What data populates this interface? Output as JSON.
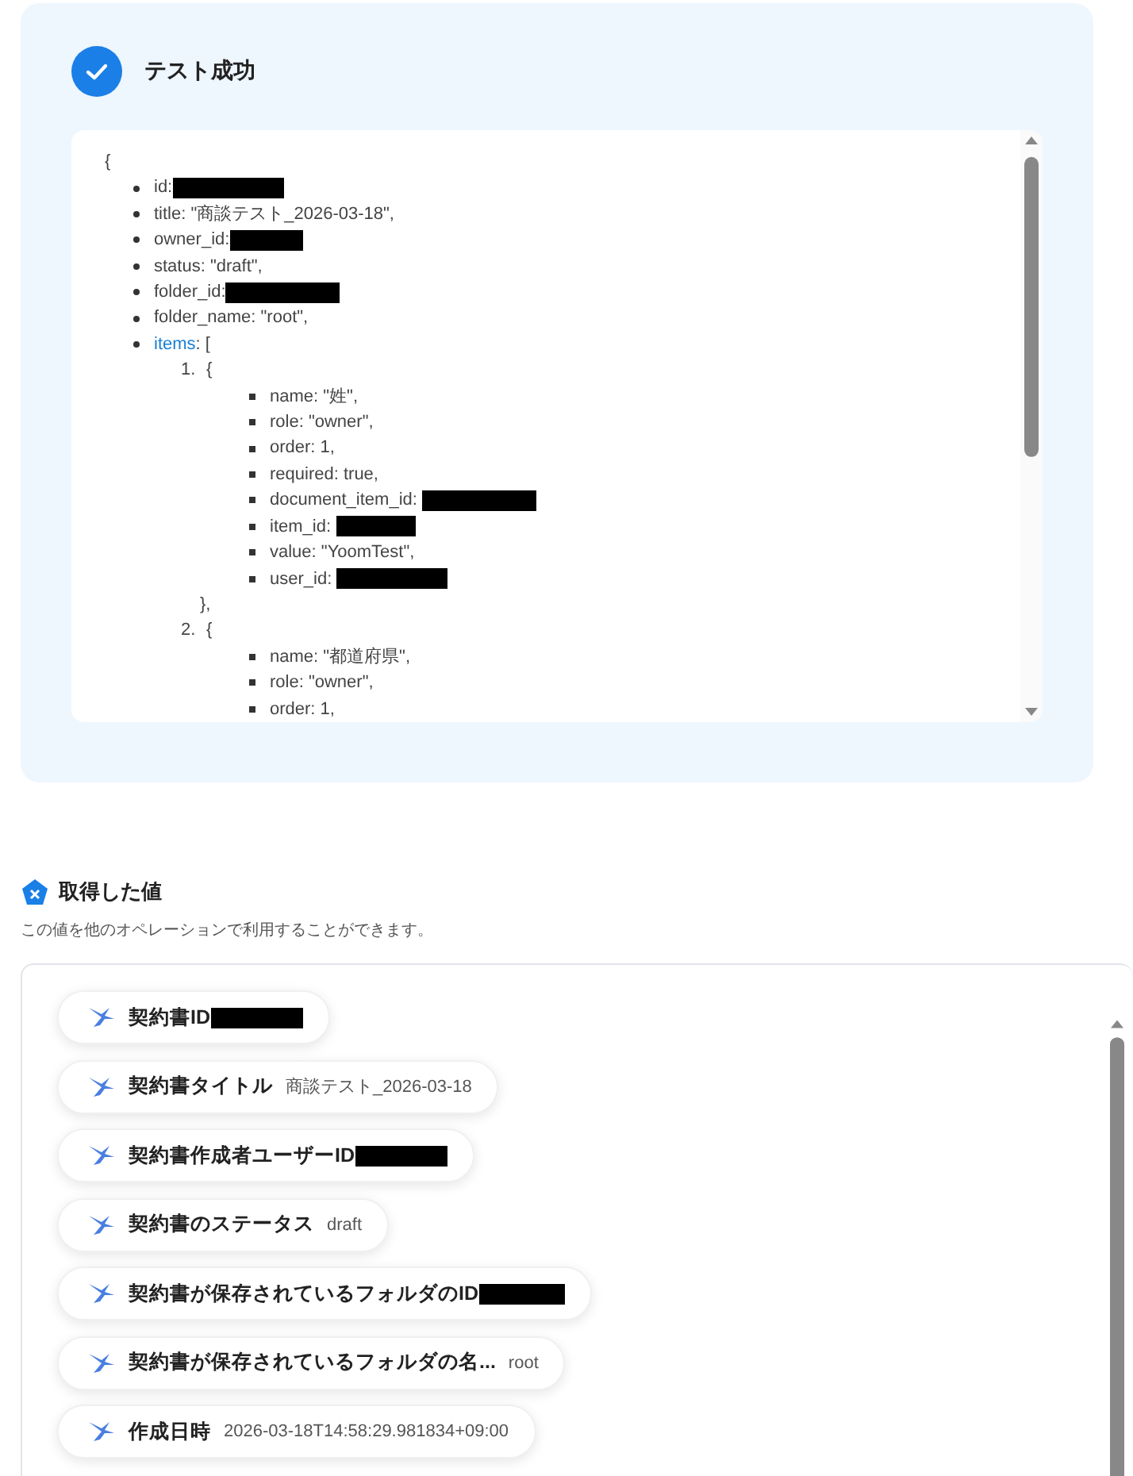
{
  "result_panel": {
    "succeeded": true,
    "title": "テスト成功",
    "code_view": {
      "open": "{",
      "fields": [
        {
          "text": "id:",
          "redacted": true
        },
        {
          "text": "title: \"商談テスト_2026-03-18\","
        },
        {
          "text": "owner_id:",
          "redacted": true
        },
        {
          "text": "status: \"draft\","
        },
        {
          "text": "folder_id:",
          "redacted": true
        },
        {
          "text": "folder_name: \"root\","
        },
        {
          "text": "items",
          "link": true,
          "suffix": ": [",
          "children": [
            {
              "marker": "1.",
              "open": "{",
              "close": "},",
              "fields": [
                {
                  "text": "name: \"姓\","
                },
                {
                  "text": "role: \"owner\","
                },
                {
                  "text": "order: 1,"
                },
                {
                  "text": "required: true,"
                },
                {
                  "text": "document_item_id:",
                  "redacted": true
                },
                {
                  "text": "item_id:",
                  "redacted": true
                },
                {
                  "text": "value: \"YoomTest\","
                },
                {
                  "text": "user_id:",
                  "redacted": true
                }
              ]
            },
            {
              "marker": "2.",
              "open": "{",
              "fields": [
                {
                  "text": "name: \"都道府県\","
                },
                {
                  "text": "role: \"owner\","
                },
                {
                  "text": "order: 1,"
                }
              ]
            }
          ]
        }
      ]
    }
  },
  "output_values": {
    "title": "取得した値",
    "description": "この値を他のオペレーションで利用することができます。",
    "items": [
      {
        "label": "契約書ID",
        "redacted": true
      },
      {
        "label": "契約書タイトル",
        "value": "商談テスト_2026-03-18"
      },
      {
        "label": "契約書作成者ユーザーID",
        "redacted": true
      },
      {
        "label": "契約書のステータス",
        "value": "draft"
      },
      {
        "label": "契約書が保存されているフォルダのID",
        "redacted": true
      },
      {
        "label": "契約書が保存されているフォルダの名...",
        "value": "root"
      },
      {
        "label": "作成日時",
        "value": "2026-03-18T14:58:29.981834+09:00"
      }
    ]
  }
}
